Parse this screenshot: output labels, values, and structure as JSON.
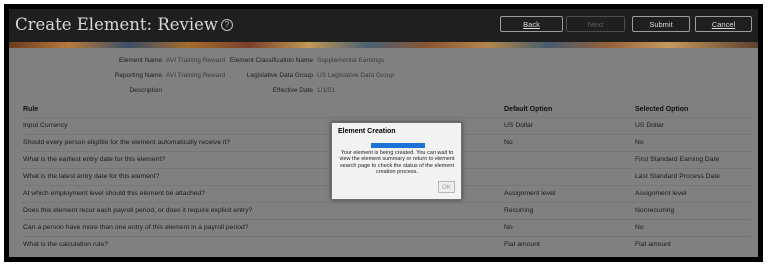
{
  "header": {
    "title": "Create Element: Review",
    "help_icon": "?",
    "buttons": {
      "back": "Back",
      "next": "Next",
      "submit": "Submit",
      "cancel": "Cancel"
    }
  },
  "summary": {
    "element_name_label": "Element Name",
    "element_name_value": "AVI Training Reward",
    "reporting_name_label": "Reporting Name",
    "reporting_name_value": "AVI Training Reward",
    "description_label": "Description",
    "classification_label": "Element Classification Name",
    "classification_value": "Supplemental Earnings",
    "ldg_label": "Legislative Data Group",
    "ldg_value": "US Legislative Data Group",
    "effective_date_label": "Effective Date",
    "effective_date_value": "1/1/51"
  },
  "table": {
    "columns": [
      "Rule",
      "Default Option",
      "Selected Option"
    ],
    "rows": [
      {
        "rule": "Input Currency",
        "default": "US Dollar",
        "selected": "US Dollar"
      },
      {
        "rule": "Should every person eligible for the element automatically receive it?",
        "default": "No",
        "selected": "No"
      },
      {
        "rule": "What is the earliest entry date for this element?",
        "default": "",
        "selected": "First Standard Earning Date"
      },
      {
        "rule": "What is the latest entry date for this element?",
        "default": "",
        "selected": "Last Standard Process Date"
      },
      {
        "rule": "At which employment level should this element be attached?",
        "default": "Assignment level",
        "selected": "Assignment level"
      },
      {
        "rule": "Does this element recur each payroll period, or does it require explicit entry?",
        "default": "Recurring",
        "selected": "Nonrecurring"
      },
      {
        "rule": "Can a person have more than one entry of this element in a payroll period?",
        "default": "No",
        "selected": "No"
      },
      {
        "rule": "What is the calculation rule?",
        "default": "Flat amount",
        "selected": "Flat amount"
      }
    ]
  },
  "modal": {
    "title": "Element Creation",
    "progress": 1.0,
    "message": "Your element is being created. You can wait to view the element summary or return to element search page to check the status of the element creation process.",
    "ok_label": "OK"
  },
  "colors": {
    "progress": "#1d72d6",
    "header_bg": "#1f1f1f",
    "overlay": "#808080"
  }
}
